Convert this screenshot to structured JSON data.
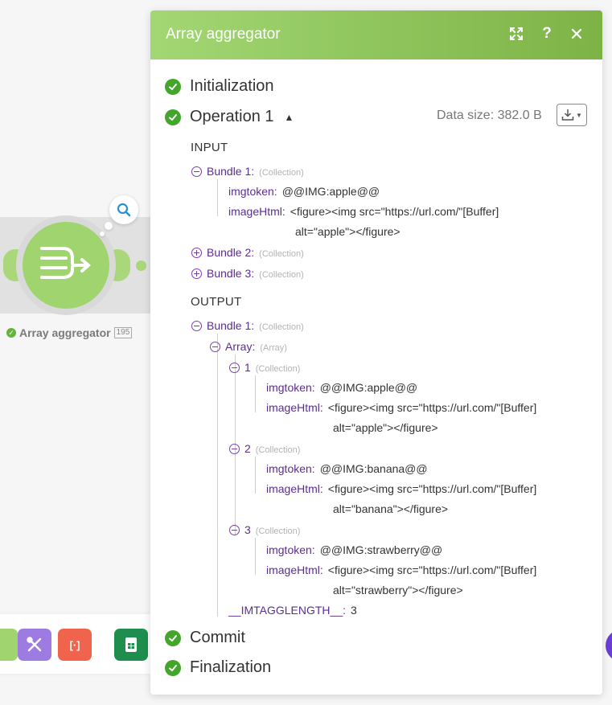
{
  "panel": {
    "title": "Array aggregator",
    "data_size": "Data size: 382.0 B",
    "phases": {
      "initialization": "Initialization",
      "operation": "Operation 1",
      "commit": "Commit",
      "finalization": "Finalization"
    },
    "input": {
      "heading": "INPUT",
      "bundles": [
        {
          "label": "Bundle 1:",
          "type": "(Collection)",
          "imgtoken_key": "imgtoken:",
          "imgtoken_val": "@@IMG:apple@@",
          "imagehtml_key": "imageHtml:",
          "imagehtml_val1": "<figure><img src=\"https://url.com/\"[Buffer]",
          "imagehtml_val2": "alt=\"apple\"></figure>"
        },
        {
          "label": "Bundle 2:",
          "type": "(Collection)"
        },
        {
          "label": "Bundle 3:",
          "type": "(Collection)"
        }
      ]
    },
    "output": {
      "heading": "OUTPUT",
      "bundle_label": "Bundle 1:",
      "bundle_type": "(Collection)",
      "array_label": "Array:",
      "array_type": "(Array)",
      "items": [
        {
          "index": "1",
          "type": "(Collection)",
          "imgtoken_key": "imgtoken:",
          "imgtoken_val": "@@IMG:apple@@",
          "imagehtml_key": "imageHtml:",
          "imagehtml_val1": "<figure><img src=\"https://url.com/\"[Buffer]",
          "imagehtml_val2": "alt=\"apple\"></figure>"
        },
        {
          "index": "2",
          "type": "(Collection)",
          "imgtoken_key": "imgtoken:",
          "imgtoken_val": "@@IMG:banana@@",
          "imagehtml_key": "imageHtml:",
          "imagehtml_val1": "<figure><img src=\"https://url.com/\"[Buffer]",
          "imagehtml_val2": "alt=\"banana\"></figure>"
        },
        {
          "index": "3",
          "type": "(Collection)",
          "imgtoken_key": "imgtoken:",
          "imgtoken_val": "@@IMG:strawberry@@",
          "imagehtml_key": "imageHtml:",
          "imagehtml_val1": "<figure><img src=\"https://url.com/\"[Buffer]",
          "imagehtml_val2": "alt=\"strawberry\"></figure>"
        }
      ],
      "length_key": "__IMTAGGLENGTH__:",
      "length_val": "3"
    }
  },
  "node": {
    "label": "Array aggregator",
    "badge": "195",
    "icon": "array-aggregator-icon"
  },
  "toolbar": {
    "red_button_label": "[·]"
  },
  "colors": {
    "header_start": "#a2d774",
    "header_end": "#7db346",
    "success": "#43a62a",
    "key": "#5c2d91"
  }
}
